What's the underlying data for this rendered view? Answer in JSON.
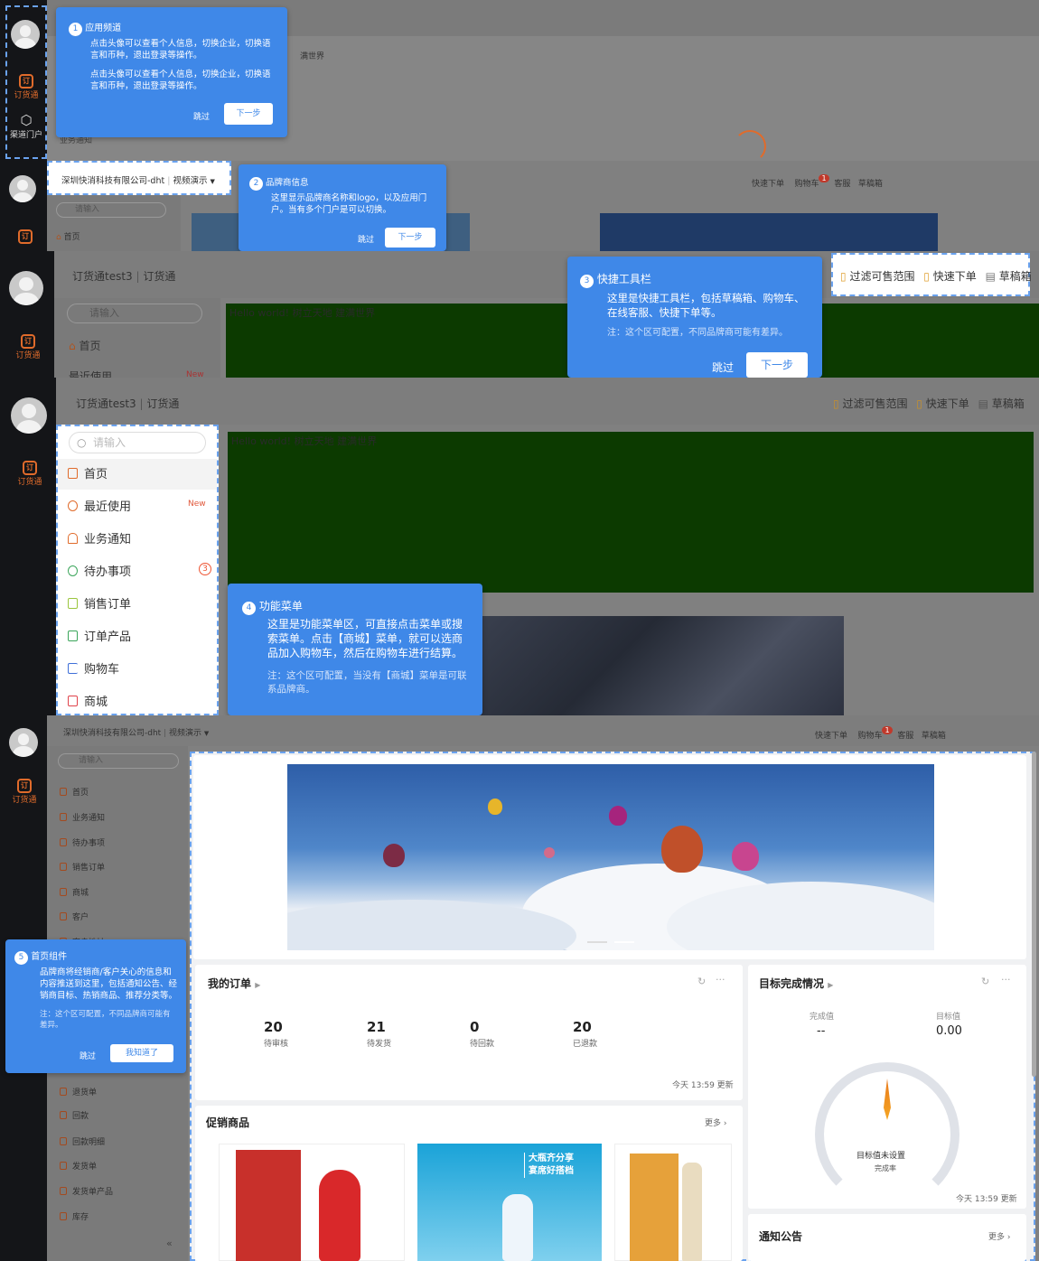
{
  "colors": {
    "accent": "#3f88e8",
    "brand": "#e06b2b",
    "sidebar": "#141518",
    "green_area": "#0c3a00"
  },
  "common": {
    "app_name": "订货通",
    "channel": "渠道门户",
    "search_placeholder": "请输入",
    "skip": "跳过",
    "next": "下一步",
    "got_it": "我知道了",
    "hello": "Hello world!  树立天地  建满世界",
    "hello_short": "满世界"
  },
  "p2": {
    "company": "深圳快消科技有限公司-dht",
    "portal": "视频演示",
    "home": "首页"
  },
  "p3": {
    "tenant": "订货通test3",
    "app": "订货通",
    "home": "首页",
    "recent": "最近使用",
    "new_badge": "New"
  },
  "toolbar": {
    "filter": "过滤可售范围",
    "quick": "快速下单",
    "cart": "购物车",
    "cart_count": "1",
    "service": "客服",
    "draft": "草稿箱"
  },
  "tips": {
    "t1": {
      "num": "1",
      "title": "应用频道",
      "body1": "点击头像可以查看个人信息，切换企业，切换语言和币种，退出登录等操作。",
      "body2": "点击头像可以查看个人信息，切换企业，切换语言和币种，退出登录等操作。"
    },
    "t2": {
      "num": "2",
      "title": "品牌商信息",
      "body": "这里显示品牌商名称和logo，以及应用门户。当有多个门户是可以切换。"
    },
    "t3": {
      "num": "3",
      "title": "快捷工具栏",
      "body": "这里是快捷工具栏，包括草稿箱、购物车、在线客服、快捷下单等。",
      "note": "注：这个区可配置，不同品牌商可能有差异。"
    },
    "t4": {
      "num": "4",
      "title": "功能菜单",
      "body": "这里是功能菜单区，可直接点击菜单或搜索菜单。点击【商城】菜单，就可以选商品加入购物车，然后在购物车进行结算。",
      "note": "注：这个区可配置，当没有【商城】菜单是可联系品牌商。"
    },
    "t5": {
      "num": "5",
      "title": "首页组件",
      "body": "品牌商将经销商/客户关心的信息和内容推送到这里，包括通知公告、经销商目标、热销商品、推荐分类等。",
      "note": "注：这个区可配置，不同品牌商可能有差异。"
    }
  },
  "menu": [
    {
      "label": "首页"
    },
    {
      "label": "最近使用"
    },
    {
      "label": "业务通知"
    },
    {
      "label": "待办事项",
      "badge": "3"
    },
    {
      "label": "销售订单"
    },
    {
      "label": "订单产品"
    },
    {
      "label": "购物车"
    },
    {
      "label": "商城"
    }
  ],
  "menu5": [
    "首页",
    "业务通知",
    "待办事项",
    "销售订单",
    "商城",
    "客户",
    "客户地址",
    "退货单",
    "回款",
    "回款明细",
    "发货单",
    "发货单产品",
    "库存"
  ],
  "orders": {
    "title": "我的订单",
    "stats": [
      {
        "value": "20",
        "label": "待审核"
      },
      {
        "value": "21",
        "label": "待发货"
      },
      {
        "value": "0",
        "label": "待回款"
      },
      {
        "value": "20",
        "label": "已退款"
      }
    ],
    "updated": "今天 13:59 更新"
  },
  "target": {
    "title": "目标完成情况",
    "done_label": "完成值",
    "done_value": "--",
    "goal_label": "目标值",
    "goal_value": "0.00",
    "gauge_text": "目标值未设置",
    "gauge_sub": "完成率",
    "updated": "今天 13:59 更新"
  },
  "promo": {
    "title": "促销商品",
    "more": "更多",
    "banner2_line1": "大瓶齐分享",
    "banner2_line2": "宴席好搭档"
  },
  "notice": {
    "title": "通知公告",
    "more": "更多"
  }
}
